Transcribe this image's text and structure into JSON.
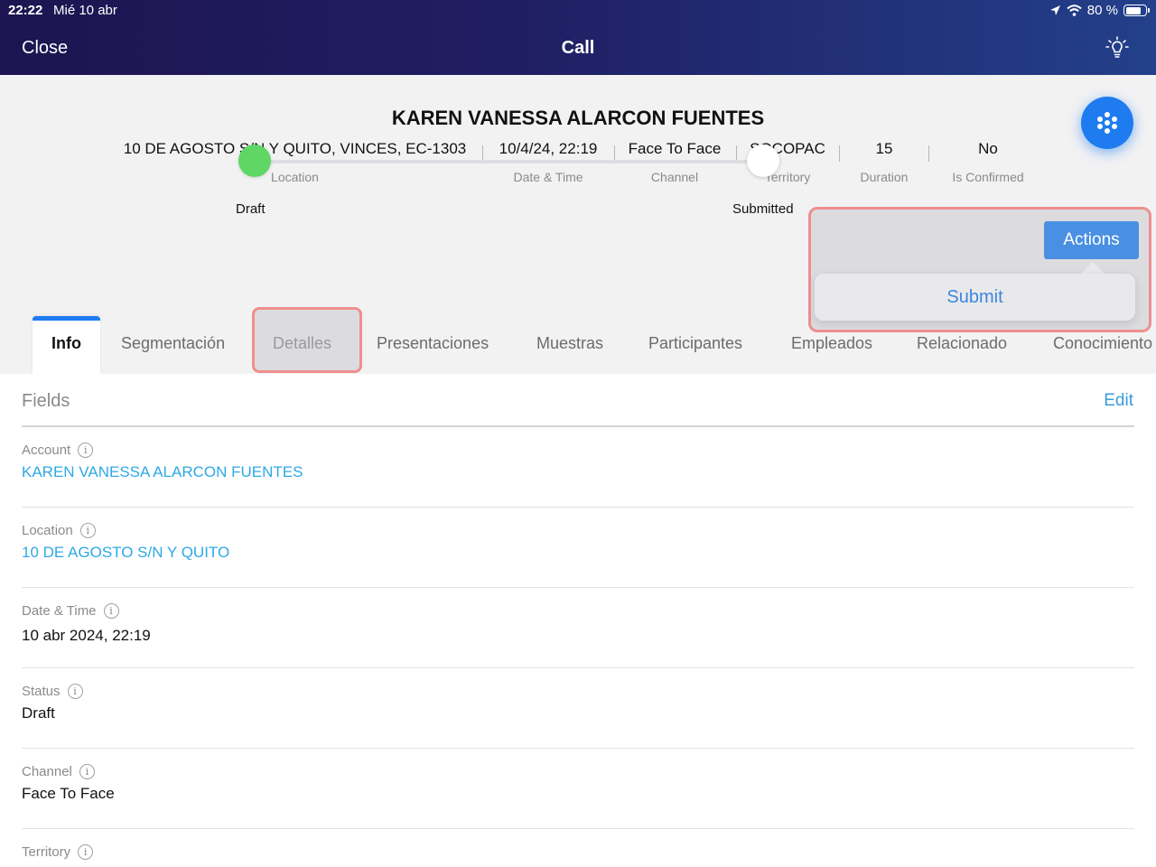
{
  "status_bar": {
    "time": "22:22",
    "date": "Mié 10 abr",
    "battery": "80 %"
  },
  "nav": {
    "close_label": "Close",
    "title": "Call"
  },
  "record": {
    "title": "KAREN VANESSA ALARCON FUENTES",
    "meta": [
      {
        "value": "10 DE AGOSTO S/N Y QUITO, VINCES, EC-1303",
        "label": "Location"
      },
      {
        "value": "10/4/24, 22:19",
        "label": "Date & Time"
      },
      {
        "value": "Face To Face",
        "label": "Channel"
      },
      {
        "value": "SOCOPAC",
        "label": "Territory"
      },
      {
        "value": "15",
        "label": "Duration"
      },
      {
        "value": "No",
        "label": "Is Confirmed"
      }
    ]
  },
  "path": {
    "steps": [
      "Draft",
      "Submitted"
    ]
  },
  "actions": {
    "button_label": "Actions",
    "options": [
      "Submit"
    ]
  },
  "tabs": [
    "Info",
    "Segmentación",
    "Detalles",
    "Presentaciones",
    "Muestras",
    "Participantes",
    "Empleados",
    "Relacionado",
    "Conocimiento"
  ],
  "fields_section": {
    "title": "Fields",
    "edit_label": "Edit",
    "info_glyph": "i",
    "fields": [
      {
        "label": "Account",
        "value": "KAREN VANESSA ALARCON FUENTES"
      },
      {
        "label": "Location",
        "value": "10 DE AGOSTO S/N Y QUITO"
      },
      {
        "label": "Date & Time",
        "value": "10 abr 2024, 22:19"
      },
      {
        "label": "Status",
        "value": "Draft"
      },
      {
        "label": "Channel",
        "value": "Face To Face"
      },
      {
        "label": "Territory",
        "value": ""
      }
    ]
  },
  "colors": {
    "accent": "#1e7bf0",
    "link": "#2ea8e6",
    "highlight": "#ef8f8f",
    "draft_green": "#5ed764"
  }
}
